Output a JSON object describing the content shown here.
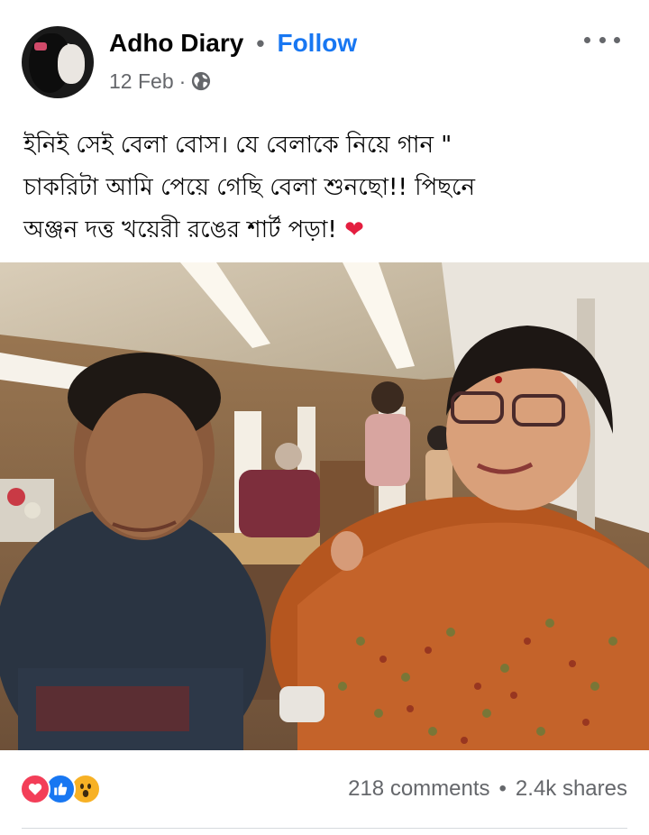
{
  "post": {
    "page_name": "Adho Diary",
    "separator": "•",
    "follow_label": "Follow",
    "timestamp": "12 Feb",
    "meta_dot": "·",
    "privacy_icon": "globe-icon",
    "more_icon": "more-options-icon",
    "caption_lines": [
      "ইনিই সেই বেলা বোস। যে বেলাকে নিয়ে গান \"",
      "চাকরিটা আমি পেয়ে গেছি বেলা শুনছো!! পিছনে",
      "অঞ্জন দত্ত খয়েরী রঙের শার্ট পড়া! "
    ],
    "caption_emoji": "❤",
    "photo_icon": "post-photo"
  },
  "engagement": {
    "reaction_icons": [
      "love-reaction-icon",
      "like-reaction-icon",
      "wow-reaction-icon"
    ],
    "comments": "218 comments",
    "separator": "•",
    "shares": "2.4k shares"
  },
  "colors": {
    "accent": "#1877f2",
    "secondary_text": "#65676b",
    "love": "#f33e58",
    "wow": "#f7b125"
  }
}
